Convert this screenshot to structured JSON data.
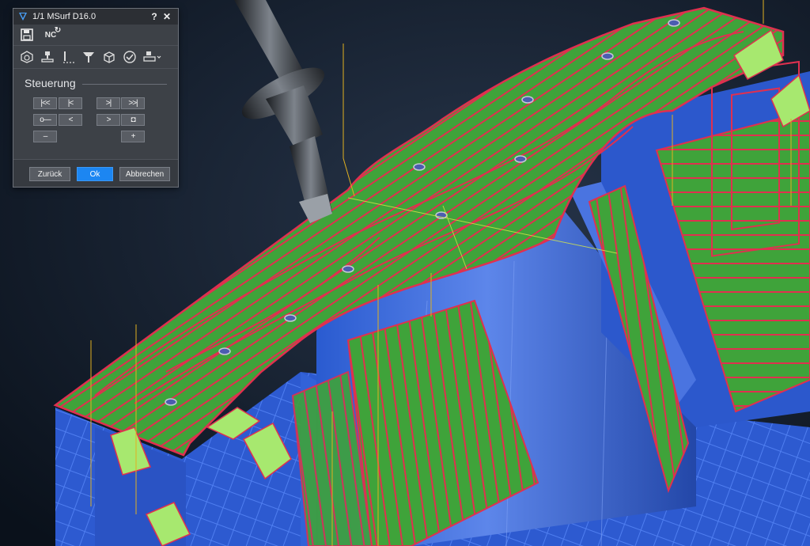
{
  "window": {
    "title": "1/1 MSurf D16.0",
    "help_label": "?",
    "close_label": "✕"
  },
  "toolbar1": {
    "save_icon": "floppy-save-icon",
    "nc_label": "NC",
    "nc_arc": "↻"
  },
  "toolbar2": {
    "icons": [
      "part-view-icon",
      "machine-icon",
      "tool-depth-icon",
      "spindle-icon",
      "stock-cube-icon",
      "check-icon",
      "fixture-dropdown-icon"
    ]
  },
  "steuerung": {
    "label": "Steuerung",
    "first": "|<<",
    "prev_step": "|<",
    "next_step": ">|",
    "last": ">>|",
    "stop_marker": "o—",
    "back": "<",
    "forward": ">",
    "stop": "◘",
    "minus": "–",
    "plus": "+"
  },
  "footer": {
    "back_label": "Zurück",
    "ok_label": "Ok",
    "cancel_label": "Abbrechen"
  },
  "colors": {
    "background": "#0d1522",
    "part_blue": "#2f5fd6",
    "toolpath_green": "#3fa33a",
    "toolpath_red": "#e0304f",
    "rapid_yellow": "#e0b020",
    "button_primary": "#1c86f2"
  }
}
